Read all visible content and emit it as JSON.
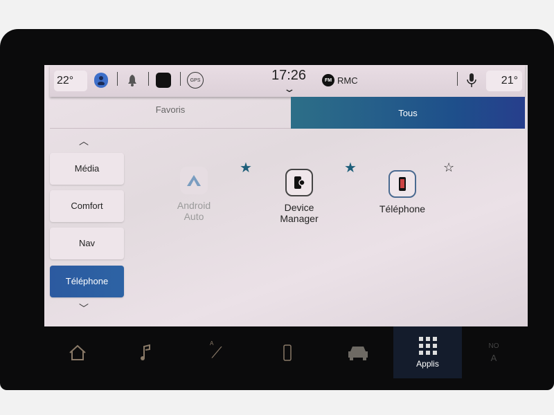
{
  "status_bar": {
    "temp_left": "22°",
    "time": "17:26",
    "radio_band": "FM",
    "radio_station": "RMC",
    "gps_label": "GPS",
    "temp_right": "21°"
  },
  "tabs": [
    {
      "label": "Favoris",
      "active": false
    },
    {
      "label": "Tous",
      "active": true
    }
  ],
  "sidebar": {
    "items": [
      {
        "label": "Média"
      },
      {
        "label": "Comfort"
      },
      {
        "label": "Nav"
      },
      {
        "label": "Téléphone",
        "active": true
      }
    ]
  },
  "apps": [
    {
      "label_1": "Android",
      "label_2": "Auto",
      "favorite": true,
      "disabled": true
    },
    {
      "label_1": "Device",
      "label_2": "Manager",
      "favorite": true
    },
    {
      "label_1": "Téléphone",
      "label_2": "",
      "favorite": false
    }
  ],
  "bottom_nav": {
    "applis_label": "Applis",
    "ac_top": "NO",
    "ac_bottom": "A",
    "seat_label": "A"
  },
  "colors": {
    "accent": "#1e4f8b",
    "star": "#1e5f7a",
    "applis_tile": "#141c2c"
  }
}
